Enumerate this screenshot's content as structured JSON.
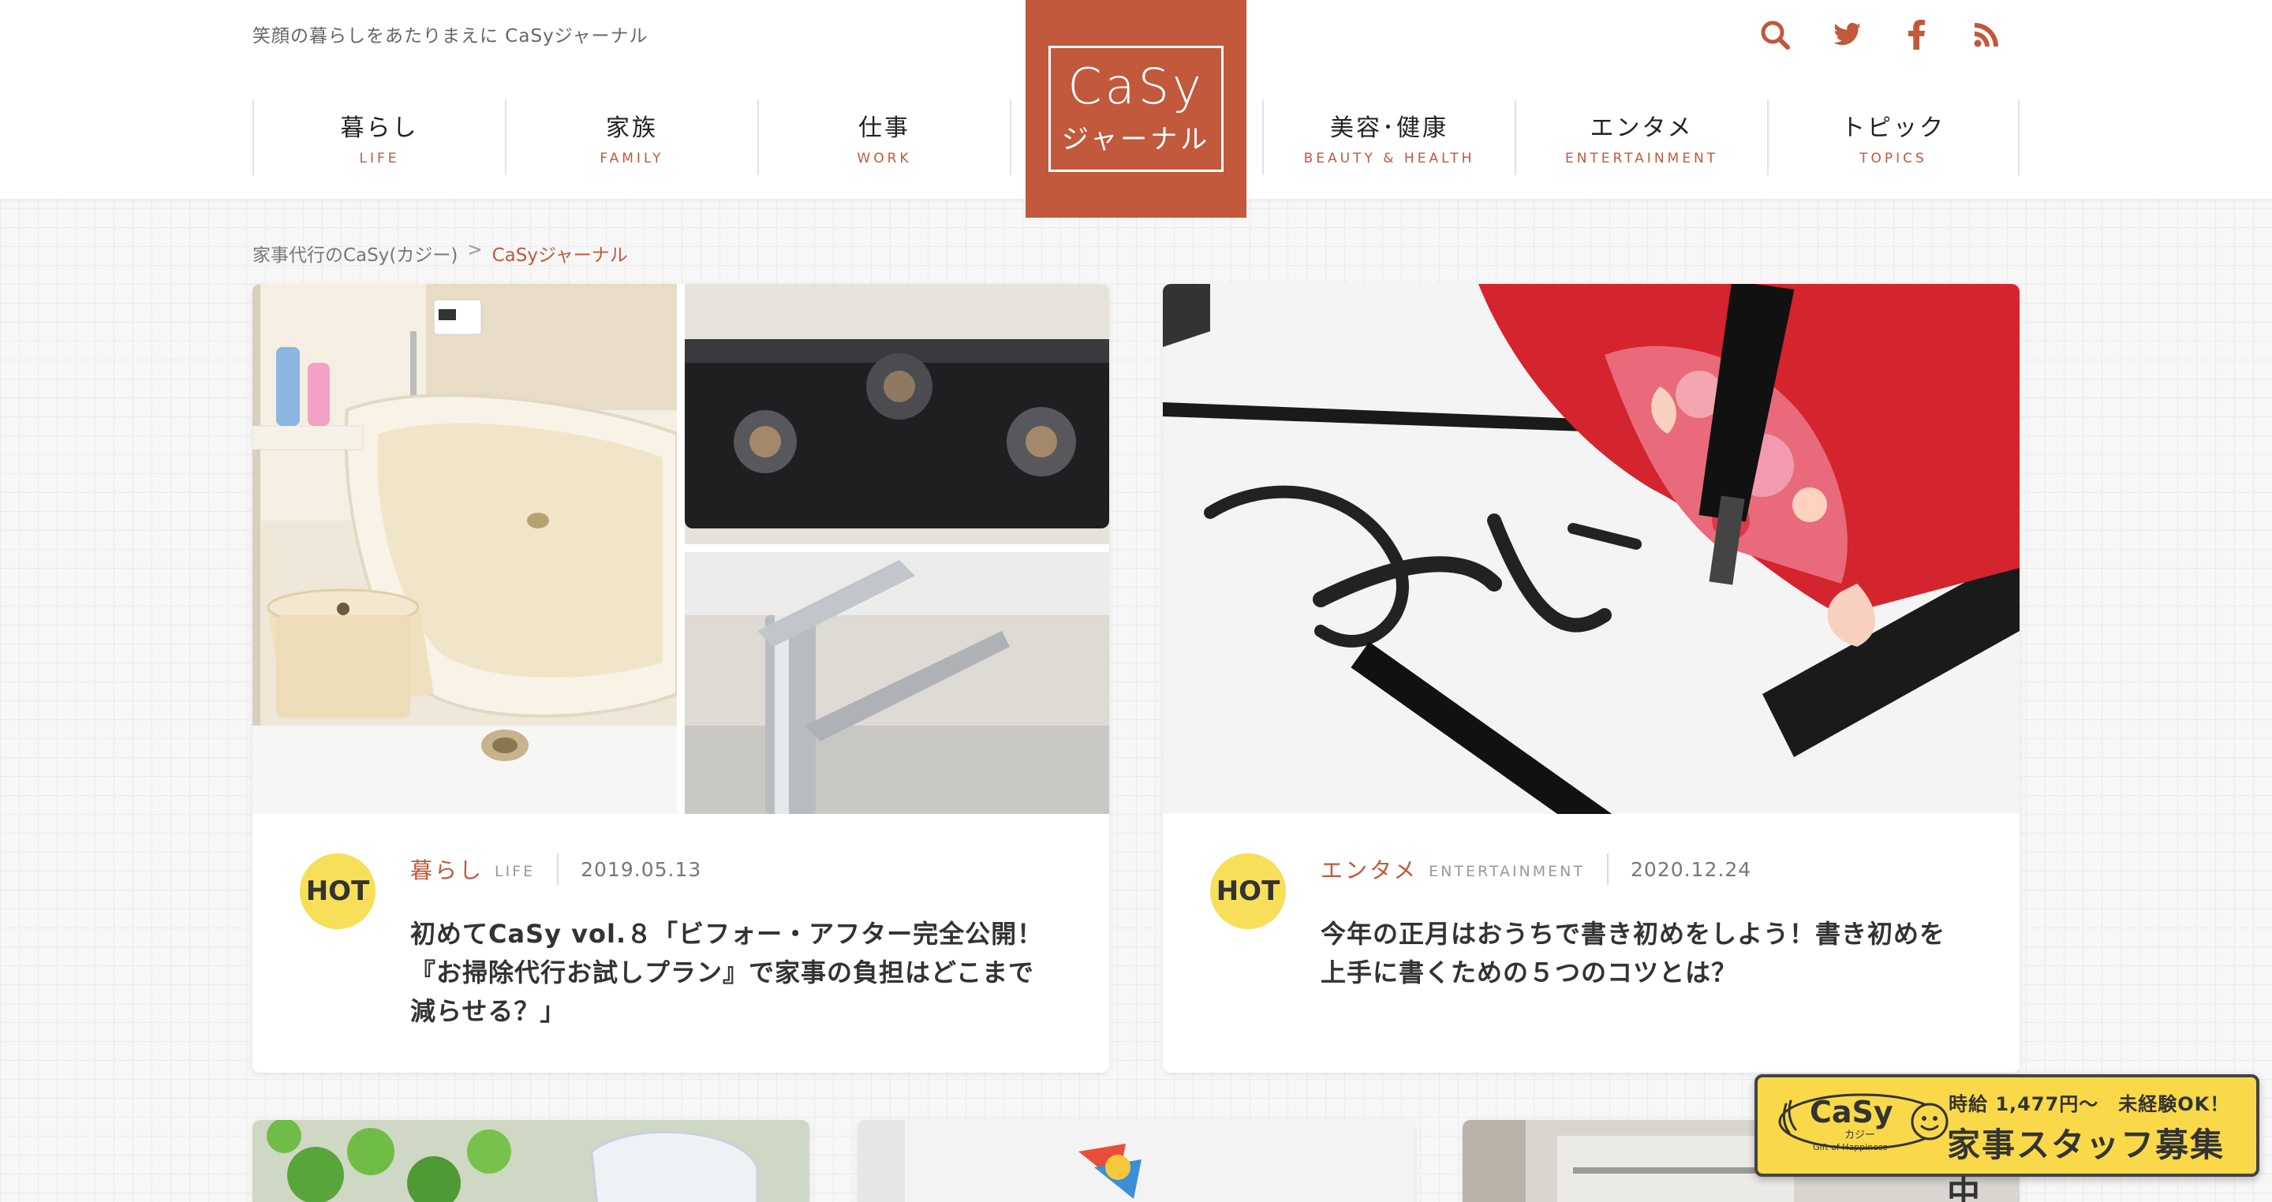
{
  "header": {
    "tagline": "笑顔の暮らしをあたりまえに CaSyジャーナル",
    "logo": {
      "main": "CaSy",
      "sub": "ジャーナル"
    },
    "nav": [
      {
        "jp": "暮らし",
        "en": "LIFE"
      },
      {
        "jp": "家族",
        "en": "FAMILY"
      },
      {
        "jp": "仕事",
        "en": "WORK"
      },
      {
        "jp": "美容･健康",
        "en": "BEAUTY & HEALTH"
      },
      {
        "jp": "エンタメ",
        "en": "ENTERTAINMENT"
      },
      {
        "jp": "トピック",
        "en": "TOPICS"
      }
    ],
    "social_icons": [
      "search-icon",
      "twitter-icon",
      "facebook-icon",
      "rss-icon"
    ]
  },
  "breadcrumb": {
    "home": "家事代行のCaSy(カジー)",
    "separator": ">",
    "current": "CaSyジャーナル"
  },
  "articles": [
    {
      "badge": "HOT",
      "category_jp": "暮らし",
      "category_en": "LIFE",
      "date": "2019.05.13",
      "title": "初めてCaSy vol.８「ビフォー・アフター完全公開！『お掃除代行お試しプラン』で家事の負担はどこまで減らせる？」"
    },
    {
      "badge": "HOT",
      "category_jp": "エンタメ",
      "category_en": "ENTERTAINMENT",
      "date": "2020.12.24",
      "title": "今年の正月はおうちで書き初めをしよう！書き初めを上手に書くための５つのコツとは？"
    }
  ],
  "banner": {
    "brand": "CaSy",
    "brand_kana": "カジー",
    "slogan": "Gift of Happiness",
    "top_text": "時給 1,477円〜　未経験OK！",
    "main_text": "家事スタッフ募集中"
  },
  "colors": {
    "accent": "#c2583c",
    "hot_badge": "#f7df5a",
    "banner_bg": "#f9d94a"
  }
}
